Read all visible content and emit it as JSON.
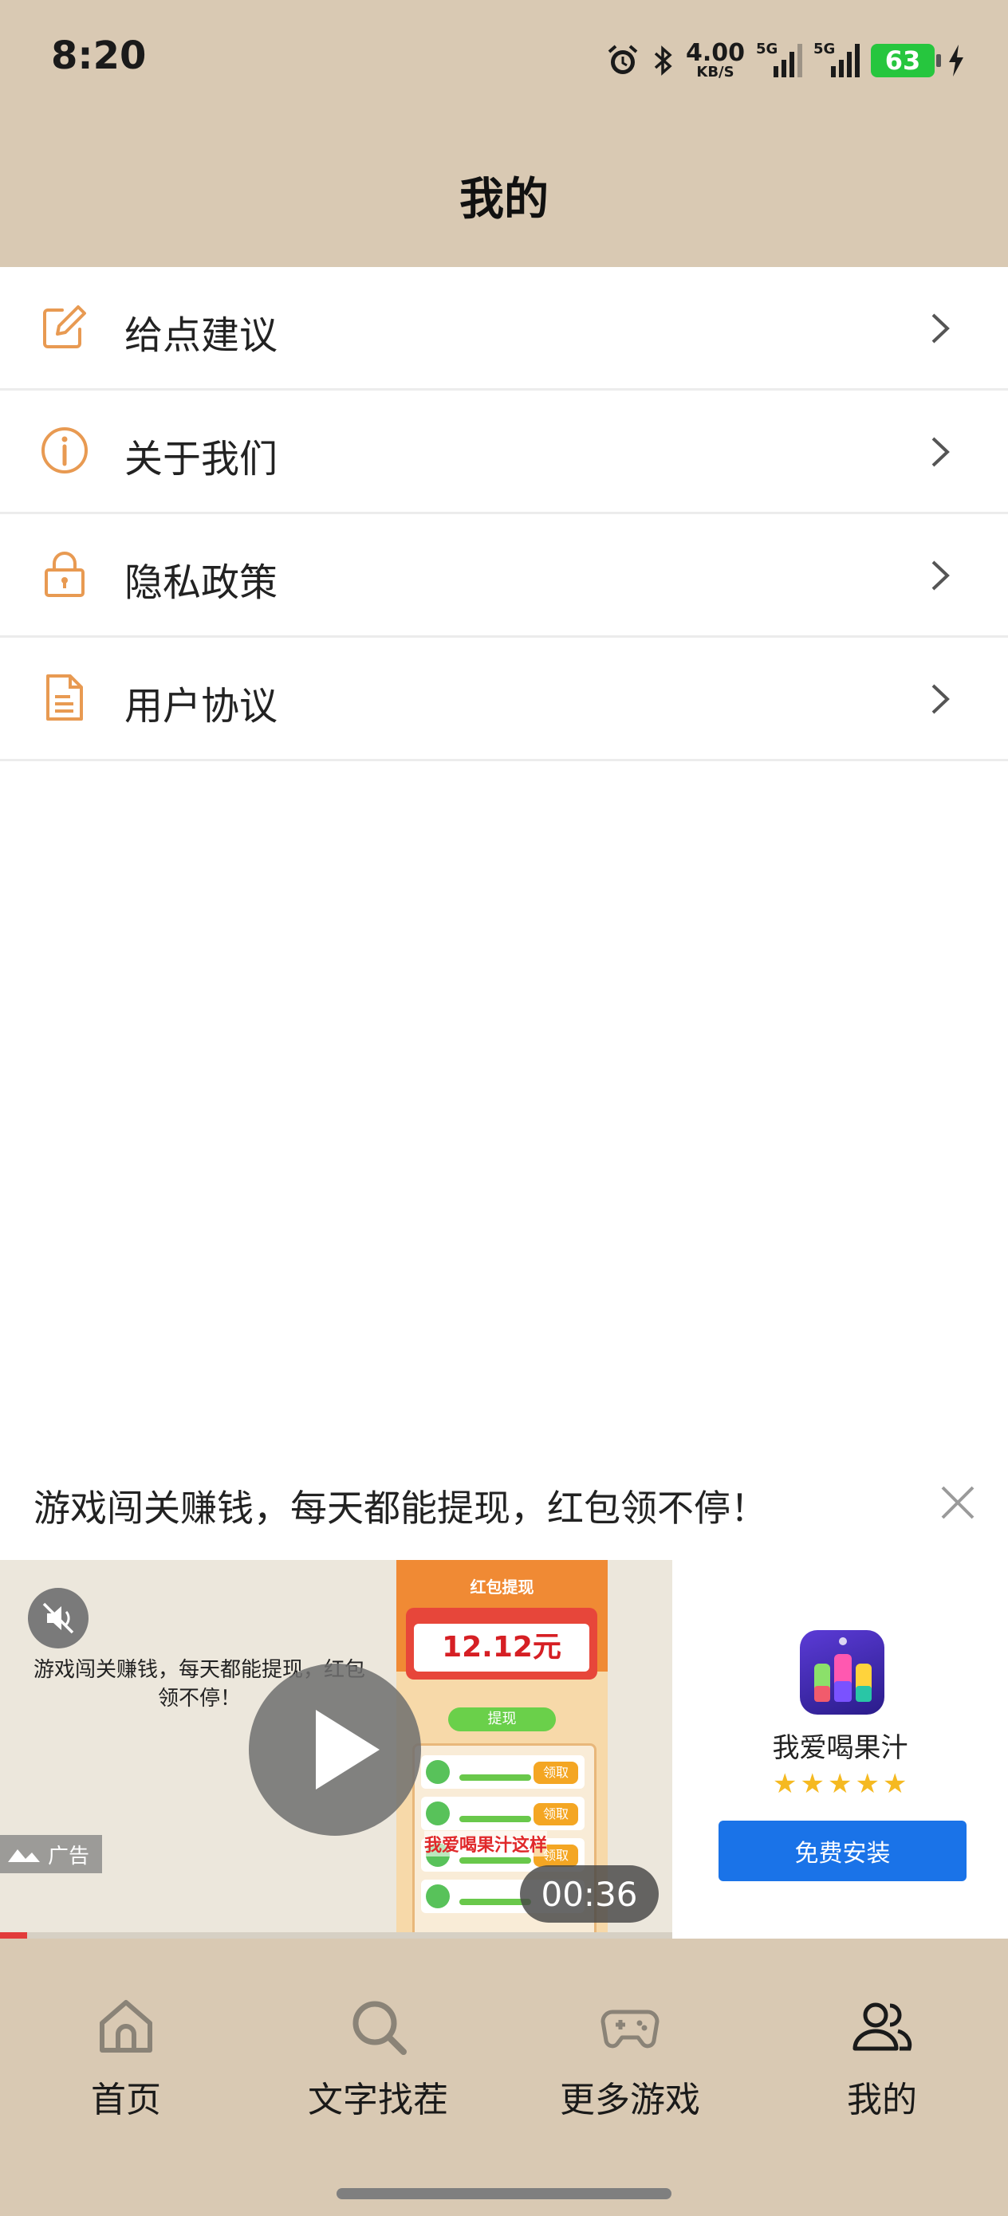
{
  "status_bar": {
    "time": "8:20",
    "net_speed_value": "4.00",
    "net_speed_unit": "KB/S",
    "signal1_label": "5G",
    "signal2_label": "5G",
    "battery": "63",
    "icons": [
      "alarm-icon",
      "bluetooth-icon",
      "signal-icon",
      "signal-icon",
      "battery-icon",
      "charging-icon"
    ]
  },
  "header": {
    "title": "我的"
  },
  "menu": {
    "items": [
      {
        "label": "给点建议",
        "icon": "edit-icon"
      },
      {
        "label": "关于我们",
        "icon": "info-icon"
      },
      {
        "label": "隐私政策",
        "icon": "lock-icon"
      },
      {
        "label": "用户协议",
        "icon": "document-icon"
      }
    ]
  },
  "ad": {
    "headline": "游戏闯关赚钱，每天都能提现，红包领不停！",
    "video_caption": "游戏闯关赚钱，每天都能提现，红包领不停！",
    "ad_tag": "广告",
    "duration": "00:36",
    "progress": 0.04,
    "phone_title": "红包提现",
    "phone_amount": "12.12元",
    "phone_withdraw": "提现",
    "phone_claim": "领取",
    "phone_watermark": "我爱喝果汁这样",
    "app_name": "我爱喝果汁",
    "rating": 5,
    "install_label": "免费安装",
    "accent_color": "#1a73e8"
  },
  "nav": {
    "items": [
      {
        "label": "首页",
        "icon": "home-icon"
      },
      {
        "label": "文字找茬",
        "icon": "search-icon"
      },
      {
        "label": "更多游戏",
        "icon": "gamepad-icon"
      },
      {
        "label": "我的",
        "icon": "users-icon"
      }
    ]
  },
  "colors": {
    "header_bg": "#d9c9b3",
    "menu_icon": "#e89a52",
    "battery": "#26c63e"
  }
}
